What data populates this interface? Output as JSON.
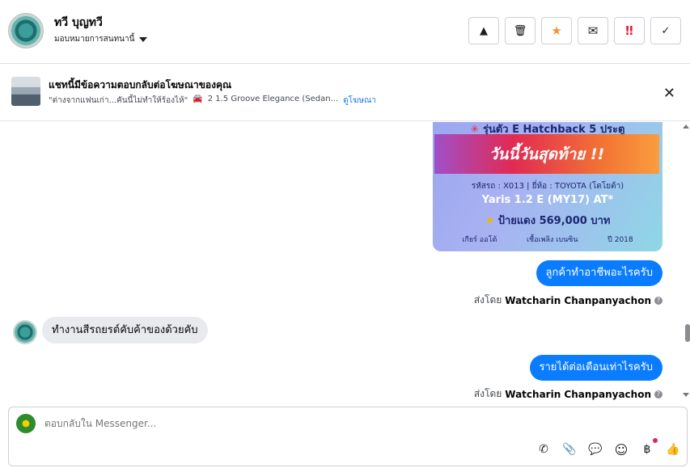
{
  "header": {
    "contact_name": "ทวี บุญทวี",
    "assign_label": "มอบหมายการสนทนานี้",
    "actions": [
      {
        "icon": "warning-icon",
        "glyph": "▲"
      },
      {
        "icon": "trash-icon",
        "glyph": "🗑"
      },
      {
        "icon": "star-icon",
        "glyph": "★"
      },
      {
        "icon": "envelope-icon",
        "glyph": "✉"
      },
      {
        "icon": "priority-icon",
        "glyph": "‼"
      },
      {
        "icon": "check-icon",
        "glyph": "✓"
      }
    ]
  },
  "ad_context": {
    "title": "แชทนี้มีข้อความตอบกลับต่อโฆษณาของคุณ",
    "quote": "\"ต่างจากแฟนเก่า...คันนี้ไม่ทำให้ร้องไห้\"",
    "car_icon": "🚘",
    "model_text": "2 1.5 Groove Elegance (Sedan...",
    "link": "ดูโฆษณา",
    "close_glyph": "✕"
  },
  "promo": {
    "headline": "รุ่นตัว E Hatchback 5 ประตู",
    "asterisk": "✳",
    "banner": "วันนี้วันสุดท้าย !!",
    "code_line": "รหัสรถ : X013 | ยี่ห้อ : TOYOTA (โตโยต้า)",
    "model": "Yaris 1.2 E (MY17) AT*",
    "price_star": "★",
    "price": "ป้ายแดง 569,000 บาท",
    "gear": "เกียร์ ออโต้",
    "fuel": "เชื้อเพลิง เบนซิน",
    "year": "ปี 2018"
  },
  "messages": {
    "out1": "ลูกค้าทำอาชีพอะไรครับ",
    "in1": "ทำงานสีรถยรต์คับค้าของด้วยคับ",
    "out2": "รายได้ต่อเดือนเท่าไรครับ",
    "sent_prefix": "ส่งโดย",
    "sender": "Watcharin Chanpanyachon",
    "info": "?"
  },
  "composer": {
    "placeholder": "ตอบกลับใน Messenger...",
    "tools": [
      {
        "icon": "phone-icon",
        "glyph": "✆"
      },
      {
        "icon": "attachment-icon",
        "glyph": "📎"
      },
      {
        "icon": "saved-reply-icon",
        "glyph": "💬"
      },
      {
        "icon": "emoji-icon",
        "glyph": "☺"
      },
      {
        "icon": "payment-icon",
        "glyph": "฿"
      },
      {
        "icon": "like-icon",
        "glyph": "👍"
      }
    ]
  }
}
